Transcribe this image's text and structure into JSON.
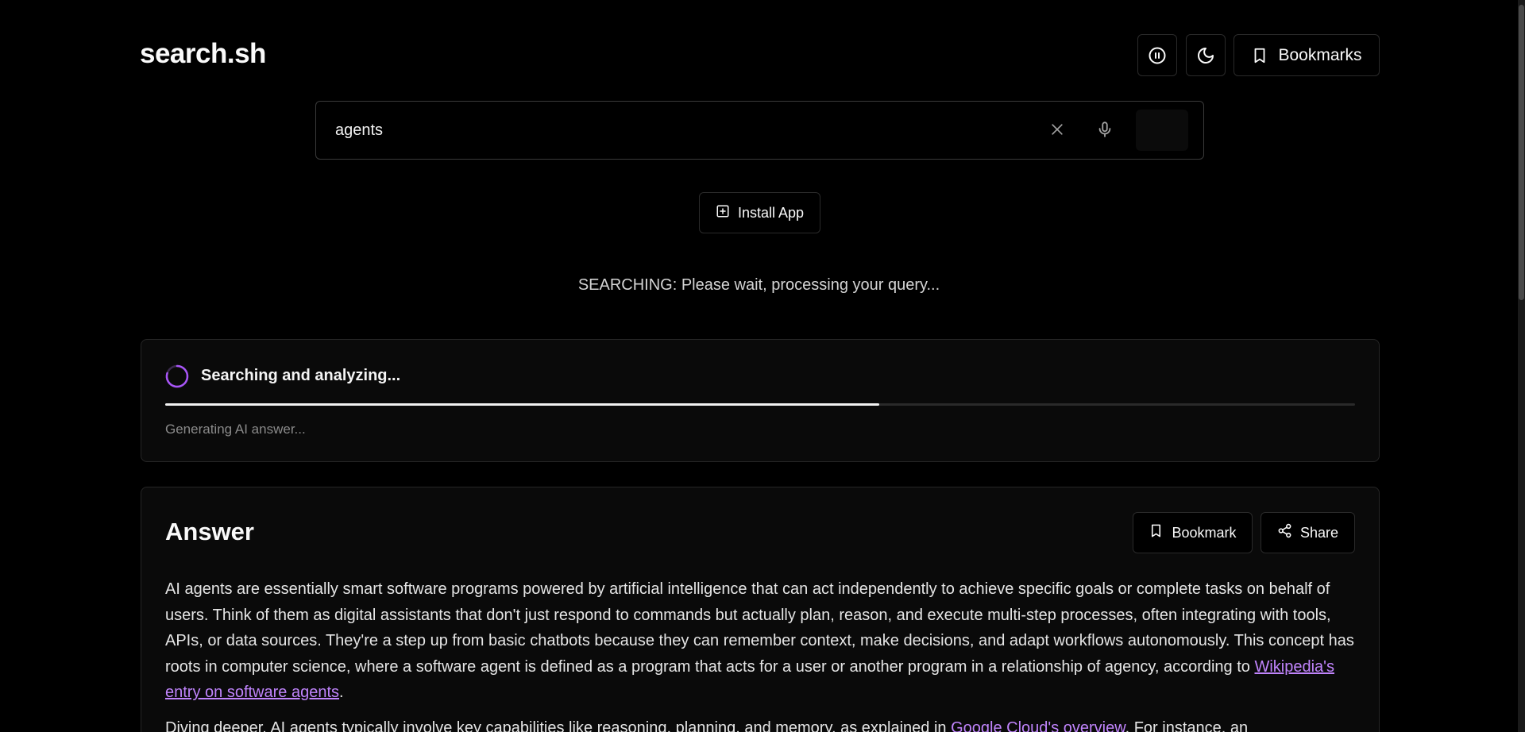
{
  "app": {
    "logo": "search.sh"
  },
  "header": {
    "pause_icon": "pause-circle-icon",
    "theme_icon": "moon-icon",
    "bookmarks_label": "Bookmarks",
    "bookmarks_icon": "bookmark-icon"
  },
  "search": {
    "value": "agents",
    "clear_icon": "close-icon",
    "mic_icon": "microphone-icon"
  },
  "install": {
    "label": "Install App",
    "icon": "plus-square-icon"
  },
  "status": {
    "text": "SEARCHING: Please wait, processing your query..."
  },
  "progress": {
    "title": "Searching and analyzing...",
    "subtitle": "Generating AI answer...",
    "fraction": 0.6,
    "accent": "#a855f7"
  },
  "answer": {
    "title": "Answer",
    "bookmark_label": "Bookmark",
    "share_label": "Share",
    "paragraph1_text": "AI agents are essentially smart software programs powered by artificial intelligence that can act independently to achieve specific goals or complete tasks on behalf of users. Think of them as digital assistants that don't just respond to commands but actually plan, reason, and execute multi-step processes, often integrating with tools, APIs, or data sources. They're a step up from basic chatbots because they can remember context, make decisions, and adapt workflows autonomously. This concept has roots in computer science, where a software agent is defined as a program that acts for a user or another program in a relationship of agency, according to ",
    "paragraph1_link": "Wikipedia's entry on software agents",
    "paragraph1_end": ".",
    "paragraph2_text": "Diving deeper, AI agents typically involve key capabilities like reasoning, planning, and memory, as explained in ",
    "paragraph2_link": "Google Cloud's overview",
    "paragraph2_end": ". For instance, an"
  },
  "colors": {
    "background": "#000000",
    "card": "#0a0a0a",
    "border": "#262626",
    "link": "#c084fc",
    "spinner": "#a855f7"
  }
}
